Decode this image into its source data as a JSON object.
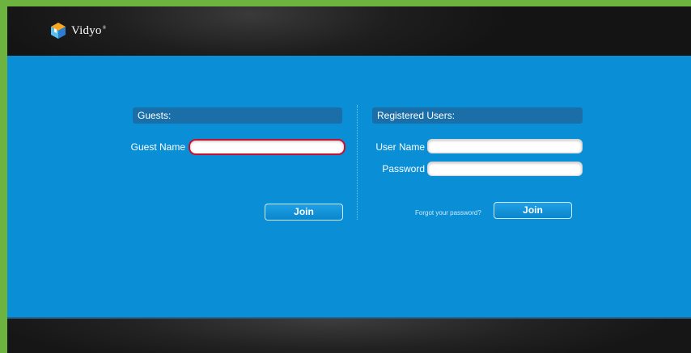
{
  "header": {
    "logo_text": "Vidyo",
    "logo_mark": "®",
    "logo_icon": "vidyo-cube-logo"
  },
  "guests": {
    "title": "Guests:",
    "guest_name_label": "Guest Name",
    "guest_name_value": "",
    "join_label": "Join"
  },
  "registered": {
    "title": "Registered Users:",
    "username_label": "User Name",
    "username_value": "",
    "password_label": "Password",
    "password_value": "",
    "forgot_label": "Forgot your password?",
    "join_label": "Join"
  },
  "colors": {
    "outer_border": "#6cb33f",
    "main_bg": "#0a8fd6",
    "section_bar": "#1a6fa8",
    "focus_ring": "#c8102e"
  }
}
